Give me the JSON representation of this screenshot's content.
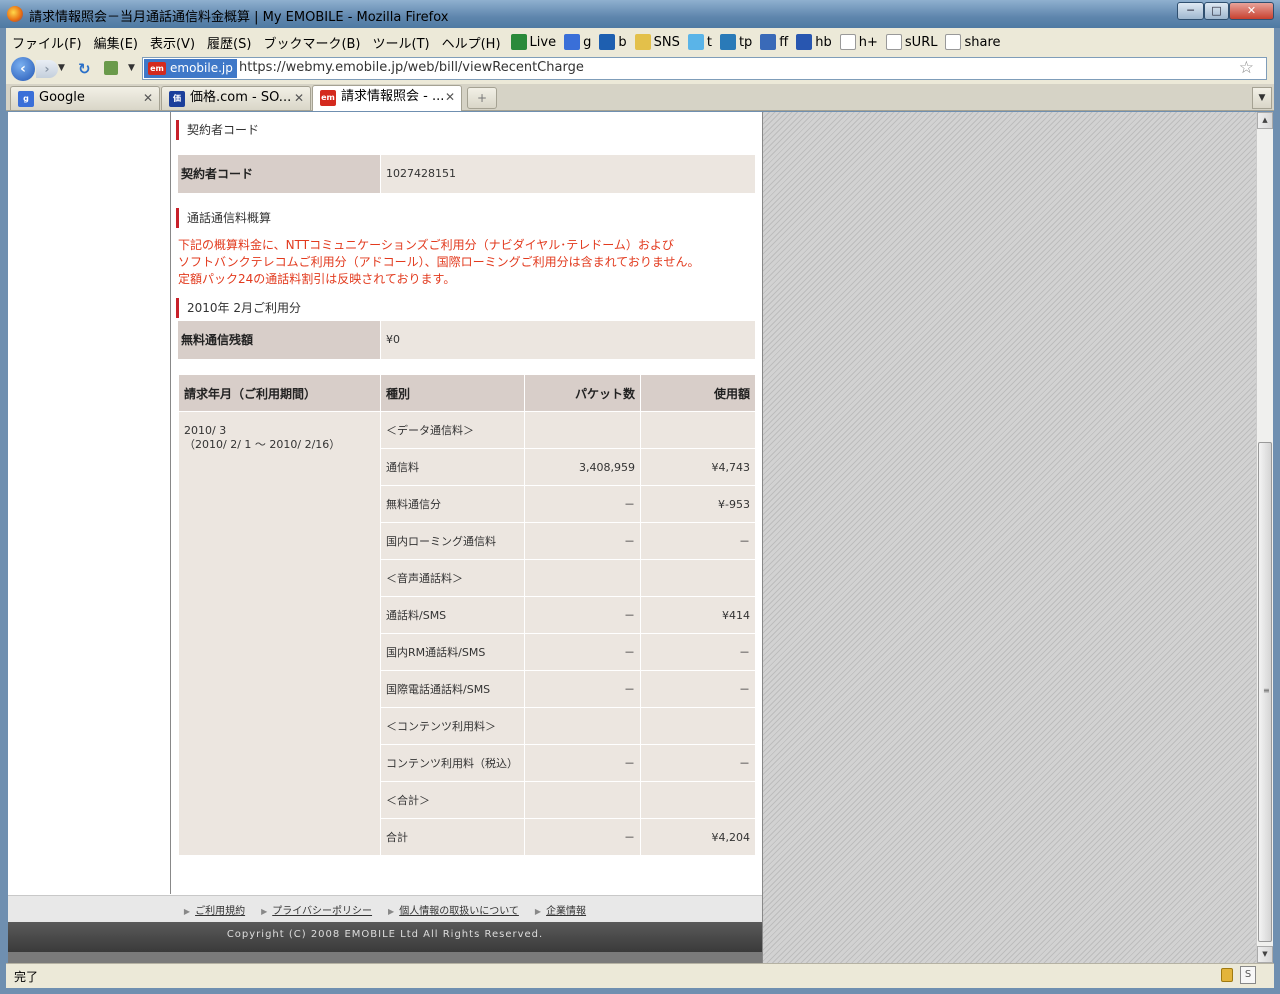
{
  "window": {
    "title": "請求情報照会－当月通話通信料金概算 | My EMOBILE - Mozilla Firefox",
    "min_glyph": "─",
    "max_glyph": "□",
    "close_glyph": "✕"
  },
  "menu": [
    {
      "label": "ファイル(F)"
    },
    {
      "label": "編集(E)"
    },
    {
      "label": "表示(V)"
    },
    {
      "label": "履歴(S)"
    },
    {
      "label": "ブックマーク(B)"
    },
    {
      "label": "ツール(T)"
    },
    {
      "label": "ヘルプ(H)"
    }
  ],
  "bookmarks": [
    {
      "label": "Live",
      "icon": "windows-flag-icon",
      "color": "#2a8a3a"
    },
    {
      "label": "g",
      "icon": "google-icon",
      "color": "#3a6fd8"
    },
    {
      "label": "b",
      "icon": "bing-icon",
      "color": "#1e5fb0"
    },
    {
      "label": "SNS",
      "icon": "folder-icon",
      "color": "#e3c04a"
    },
    {
      "label": "t",
      "icon": "twitter-icon",
      "color": "#5ab4e8"
    },
    {
      "label": "tp",
      "icon": "tp-icon",
      "color": "#2a7ab8"
    },
    {
      "label": "ff",
      "icon": "ff-icon",
      "color": "#3a6ab8"
    },
    {
      "label": "hb",
      "icon": "hatena-icon",
      "color": "#2856b0"
    },
    {
      "label": "h+",
      "icon": "page-icon",
      "color": "#ffffff"
    },
    {
      "label": "sURL",
      "icon": "page-icon",
      "color": "#ffffff"
    },
    {
      "label": "share",
      "icon": "page-icon",
      "color": "#ffffff"
    }
  ],
  "nav": {
    "site_identity": "emobile.jp",
    "site_logo": "em",
    "url": "https://webmy.emobile.jp/web/bill/viewRecentCharge"
  },
  "tabs": [
    {
      "label": "Google",
      "icon_text": "g",
      "color": "#3a6fd8"
    },
    {
      "label": "価格.com - SO...",
      "icon_text": "価",
      "color": "#1b3f9b"
    },
    {
      "label": "請求情報照会 - ...",
      "icon_text": "em",
      "color": "#d42a1e"
    }
  ],
  "page": {
    "contract_section": "契約者コード",
    "contract_label": "契約者コード",
    "contract_value": "1027428151",
    "summary_section": "通話通信料概算",
    "notice": [
      "下記の概算料金に、NTTコミュニケーションズご利用分（ナビダイヤル･テレドーム）および",
      "ソフトバンクテレコムご利用分（アドコール）、国際ローミングご利用分は含まれておりません。",
      "定額パック24の通話料割引は反映されております。"
    ],
    "usage_section": "2010年 2月ご利用分",
    "free_label": "無料通信残額",
    "free_value": "¥0",
    "table_headers": [
      "請求年月（ご利用期間）",
      "種別",
      "パケット数",
      "使用額"
    ],
    "period_line1": "2010/ 3",
    "period_line2": "（2010/ 2/ 1 ～ 2010/ 2/16）",
    "rows": [
      {
        "type": "＜データ通信料＞",
        "packets": "",
        "amount": ""
      },
      {
        "type": "通信料",
        "packets": "3,408,959",
        "amount": "¥4,743"
      },
      {
        "type": "無料通信分",
        "packets": "－",
        "amount": "¥-953"
      },
      {
        "type": "国内ローミング通信料",
        "packets": "－",
        "amount": "－"
      },
      {
        "type": "＜音声通話料＞",
        "packets": "",
        "amount": ""
      },
      {
        "type": "通話料/SMS",
        "packets": "－",
        "amount": "¥414"
      },
      {
        "type": "国内RM通話料/SMS",
        "packets": "－",
        "amount": "－"
      },
      {
        "type": "国際電話通話料/SMS",
        "packets": "－",
        "amount": "－"
      },
      {
        "type": "＜コンテンツ利用料＞",
        "packets": "",
        "amount": ""
      },
      {
        "type": "コンテンツ利用料（税込）",
        "packets": "－",
        "amount": "－"
      },
      {
        "type": "＜合計＞",
        "packets": "",
        "amount": ""
      },
      {
        "type": "合計",
        "packets": "－",
        "amount": "¥4,204"
      }
    ]
  },
  "footer": {
    "links": [
      "ご利用規約",
      "プライバシーポリシー",
      "個人情報の取扱いについて",
      "企業情報"
    ],
    "copyright": "Copyright (C) 2008 EMOBILE Ltd All Rights Reserved."
  },
  "status": {
    "text": "完了"
  }
}
